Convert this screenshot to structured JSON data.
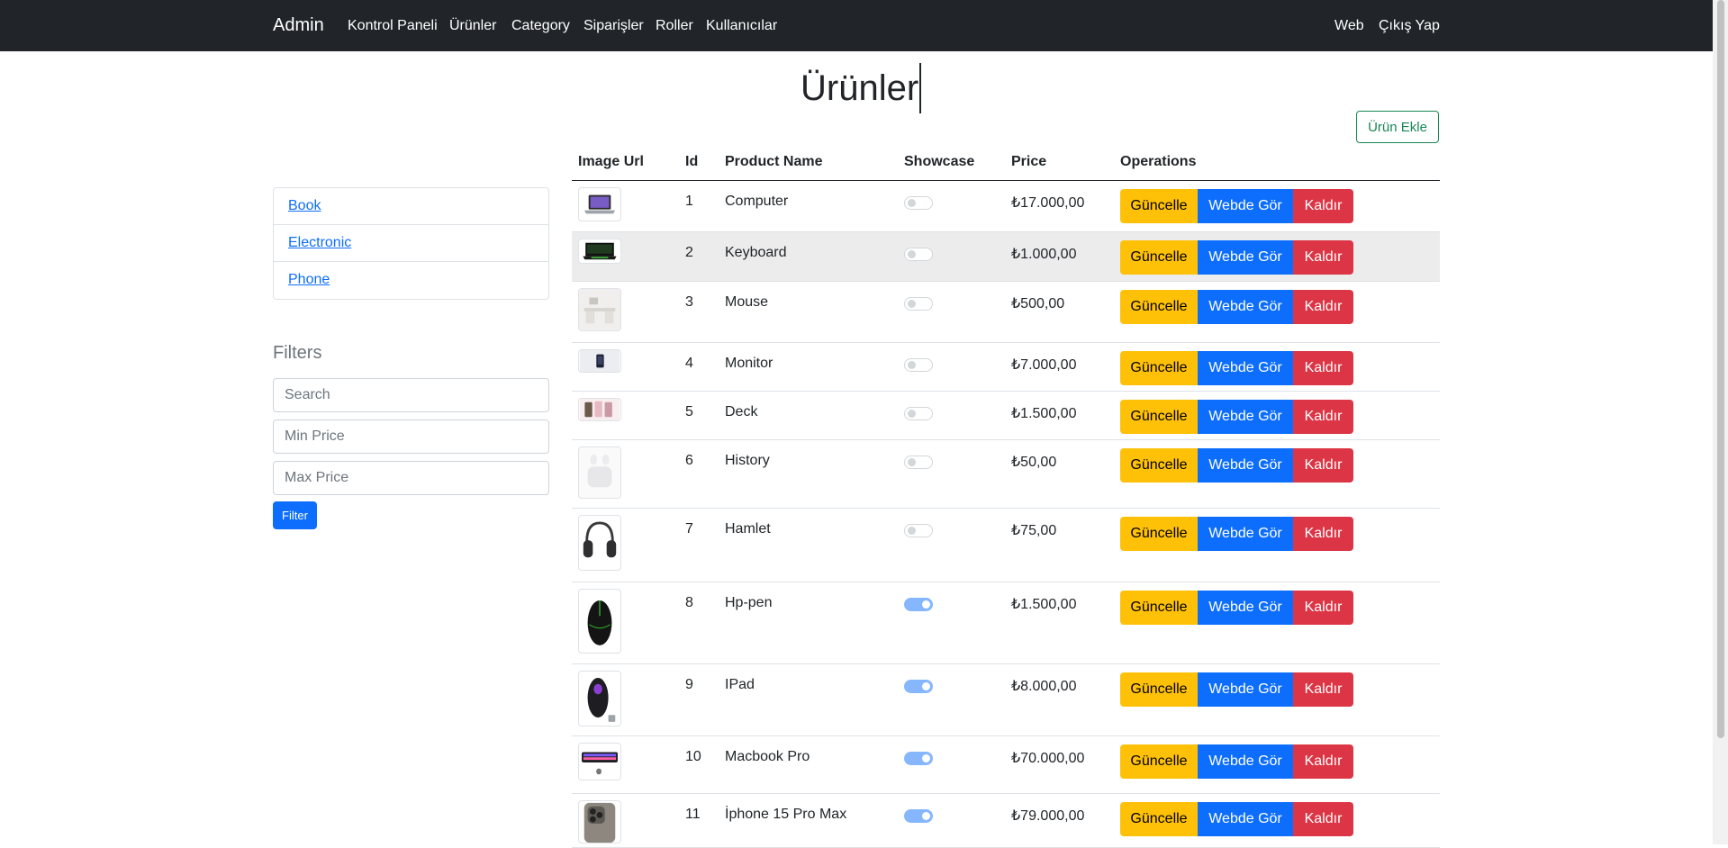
{
  "navbar": {
    "brand": "Admin",
    "links": [
      "Kontrol Paneli",
      "Ürünler",
      "Category",
      "Siparişler",
      "Roller",
      "Kullanıcılar"
    ],
    "right_links": [
      "Web",
      "Çıkış Yap"
    ]
  },
  "page": {
    "title": "Ürünler",
    "add_button": "Ürün Ekle"
  },
  "categories": [
    "Book",
    "Electronic",
    "Phone"
  ],
  "filters": {
    "title": "Filters",
    "search_placeholder": "Search",
    "min_placeholder": "Min Price",
    "max_placeholder": "Max Price",
    "button": "Filter"
  },
  "table": {
    "headers": [
      "Image Url",
      "Id",
      "Product Name",
      "Showcase",
      "Price",
      "Operations"
    ],
    "buttons": {
      "update": "Güncelle",
      "view": "Webde Gör",
      "remove": "Kaldır"
    },
    "rows": [
      {
        "id": "1",
        "name": "Computer",
        "showcase": false,
        "price": "₺17.000,00",
        "image": "laptop-thumbnail"
      },
      {
        "id": "2",
        "name": "Keyboard",
        "showcase": false,
        "price": "₺1.000,00",
        "image": "gaming-laptop-thumbnail"
      },
      {
        "id": "3",
        "name": "Mouse",
        "showcase": false,
        "price": "₺500,00",
        "image": "desk-thumbnail"
      },
      {
        "id": "4",
        "name": "Monitor",
        "showcase": false,
        "price": "₺7.000,00",
        "image": "phone-thumbnail"
      },
      {
        "id": "5",
        "name": "Deck",
        "showcase": false,
        "price": "₺1.500,00",
        "image": "phones-thumbnail"
      },
      {
        "id": "6",
        "name": "History",
        "showcase": false,
        "price": "₺50,00",
        "image": "earbuds-thumbnail"
      },
      {
        "id": "7",
        "name": "Hamlet",
        "showcase": false,
        "price": "₺75,00",
        "image": "headphones-thumbnail"
      },
      {
        "id": "8",
        "name": "Hp-pen",
        "showcase": true,
        "price": "₺1.500,00",
        "image": "mouse-thumbnail"
      },
      {
        "id": "9",
        "name": "IPad",
        "showcase": true,
        "price": "₺8.000,00",
        "image": "rgb-mouse-thumbnail"
      },
      {
        "id": "10",
        "name": "Macbook Pro",
        "showcase": true,
        "price": "₺70.000,00",
        "image": "keyboard-thumbnail"
      },
      {
        "id": "11",
        "name": "İphone 15 Pro Max",
        "showcase": true,
        "price": "₺79.000,00",
        "image": "iphone-thumbnail"
      }
    ]
  },
  "colors": {
    "navbar": "#212529",
    "primary": "#0d6efd",
    "warning": "#ffc107",
    "danger": "#dc3545",
    "success": "#198754",
    "toggle_on": "#86b7fe"
  }
}
